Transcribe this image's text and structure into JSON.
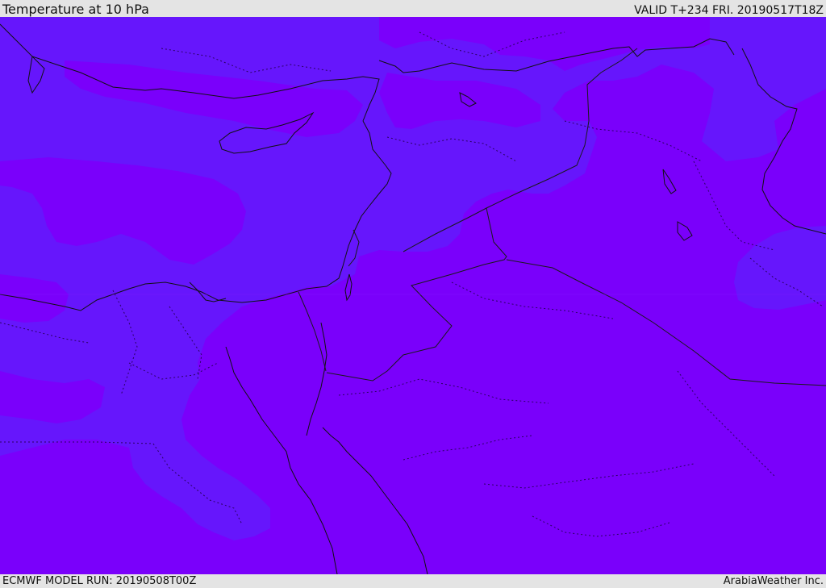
{
  "header": {
    "title": "Temperature at 10 hPa",
    "valid_time": "VALID T+234 FRI. 20190517T18Z"
  },
  "footer": {
    "model_run": "ECMWF MODEL RUN: 20190508T00Z",
    "credit": "ArabiaWeather Inc."
  },
  "map": {
    "field": "temperature",
    "level": "10 hPa",
    "colors": {
      "background_band": "#7a00fb",
      "contour_band": "#6616fc",
      "coastline": "#111111",
      "border": "#1a1a1a"
    }
  }
}
